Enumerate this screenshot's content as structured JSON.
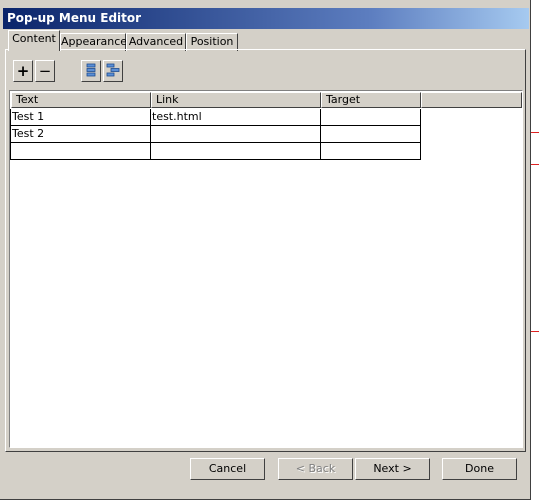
{
  "window": {
    "title": "Pop-up Menu Editor"
  },
  "tabs": [
    {
      "label": "Content",
      "active": true
    },
    {
      "label": "Appearance",
      "active": false
    },
    {
      "label": "Advanced",
      "active": false
    },
    {
      "label": "Position",
      "active": false
    }
  ],
  "toolbar": {
    "add_symbol": "+",
    "remove_symbol": "−",
    "icons": [
      "add-item-icon",
      "remove-item-icon",
      "indent-icon",
      "outdent-icon"
    ]
  },
  "table": {
    "columns": [
      "Text",
      "Link",
      "Target"
    ],
    "rows": [
      [
        "Test 1",
        "test.html",
        ""
      ],
      [
        "Test 2",
        "",
        ""
      ],
      [
        "",
        "",
        ""
      ]
    ]
  },
  "buttons": {
    "cancel": "Cancel",
    "back": "< Back",
    "next": "Next >",
    "done": "Done"
  },
  "colors": {
    "titlebar_start": "#0a246a",
    "titlebar_end": "#a6caf0",
    "dialog_bg": "#d4d0c8"
  }
}
